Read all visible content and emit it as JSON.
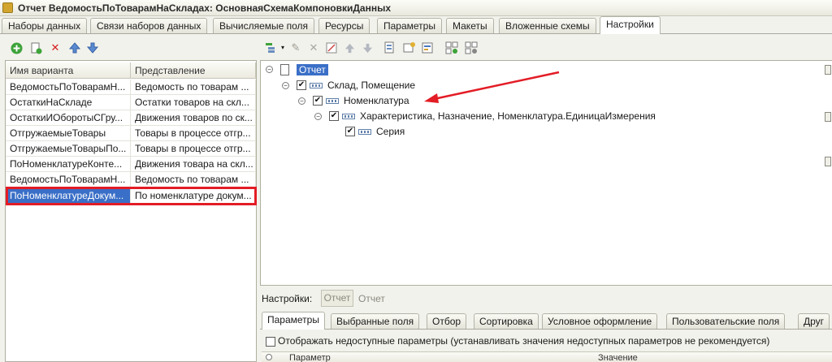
{
  "window": {
    "title": "Отчет ВедомостьПоТоварамНаСкладах: ОсновнаяСхемаКомпоновкиДанных"
  },
  "top_tabs": [
    {
      "label": "Наборы данных"
    },
    {
      "label": "Связи наборов данных"
    },
    {
      "label": "Вычисляемые поля"
    },
    {
      "label": "Ресурсы"
    },
    {
      "label": "Параметры"
    },
    {
      "label": "Макеты"
    },
    {
      "label": "Вложенные схемы"
    },
    {
      "label": "Настройки",
      "active": true
    }
  ],
  "left_toolbar": [
    "add-icon",
    "copy-icon",
    "delete-icon",
    "move-up-icon",
    "move-down-icon"
  ],
  "variants": {
    "headers": [
      "Имя варианта",
      "Представление"
    ],
    "rows": [
      [
        "ВедомостьПоТоварамН...",
        "Ведомость по товарам ..."
      ],
      [
        "ОстаткиНаСкладе",
        "Остатки товаров на скл..."
      ],
      [
        "ОстаткиИОборотыСГру...",
        "Движения товаров по ск..."
      ],
      [
        "ОтгружаемыеТовары",
        "Товары в процессе отгр..."
      ],
      [
        "ОтгружаемыеТоварыПо...",
        "Товары в процессе отгр..."
      ],
      [
        "ПоНоменклатуреКонте...",
        "Движения товара на скл..."
      ],
      [
        "ВедомостьПоТоварамН...",
        "Ведомость по товарам ..."
      ],
      [
        "ПоНоменклатуреДокум...",
        "По номенклатуре докум..."
      ]
    ],
    "selected_index": 7
  },
  "right_toolbar": [
    "add-grouping-icon",
    "edit-icon",
    "delete-icon",
    "wizard-icon",
    "move-up-icon",
    "move-down-icon",
    "group-icon",
    "ungroup-icon",
    "level-up-icon",
    "level-down-icon",
    "fields-icon",
    "settings-icon"
  ],
  "tree": {
    "root": "Отчет",
    "nodes": [
      {
        "label": "Склад, Помещение",
        "level": 1
      },
      {
        "label": "Номенклатура",
        "level": 2
      },
      {
        "label": "Характеристика, Назначение, Номенклатура.ЕдиницаИзмерения",
        "level": 3
      },
      {
        "label": "Серия",
        "level": 4
      }
    ]
  },
  "settings": {
    "label": "Настройки:",
    "button": "Отчет",
    "current": "Отчет"
  },
  "bottom_tabs": [
    {
      "label": "Параметры",
      "active": true
    },
    {
      "label": "Выбранные поля"
    },
    {
      "label": "Отбор"
    },
    {
      "label": "Сортировка"
    },
    {
      "label": "Условное оформление"
    },
    {
      "label": "Пользовательские поля"
    },
    {
      "label": "Друг"
    }
  ],
  "show_unavailable": "Отображать недоступные параметры (устанавливать значения недоступных параметров не рекомендуется)",
  "param_table": {
    "headers": [
      "Параметр",
      "Значение"
    ]
  },
  "colors": {
    "selection": "#3a6fc7",
    "annotation": "#e31c25"
  }
}
